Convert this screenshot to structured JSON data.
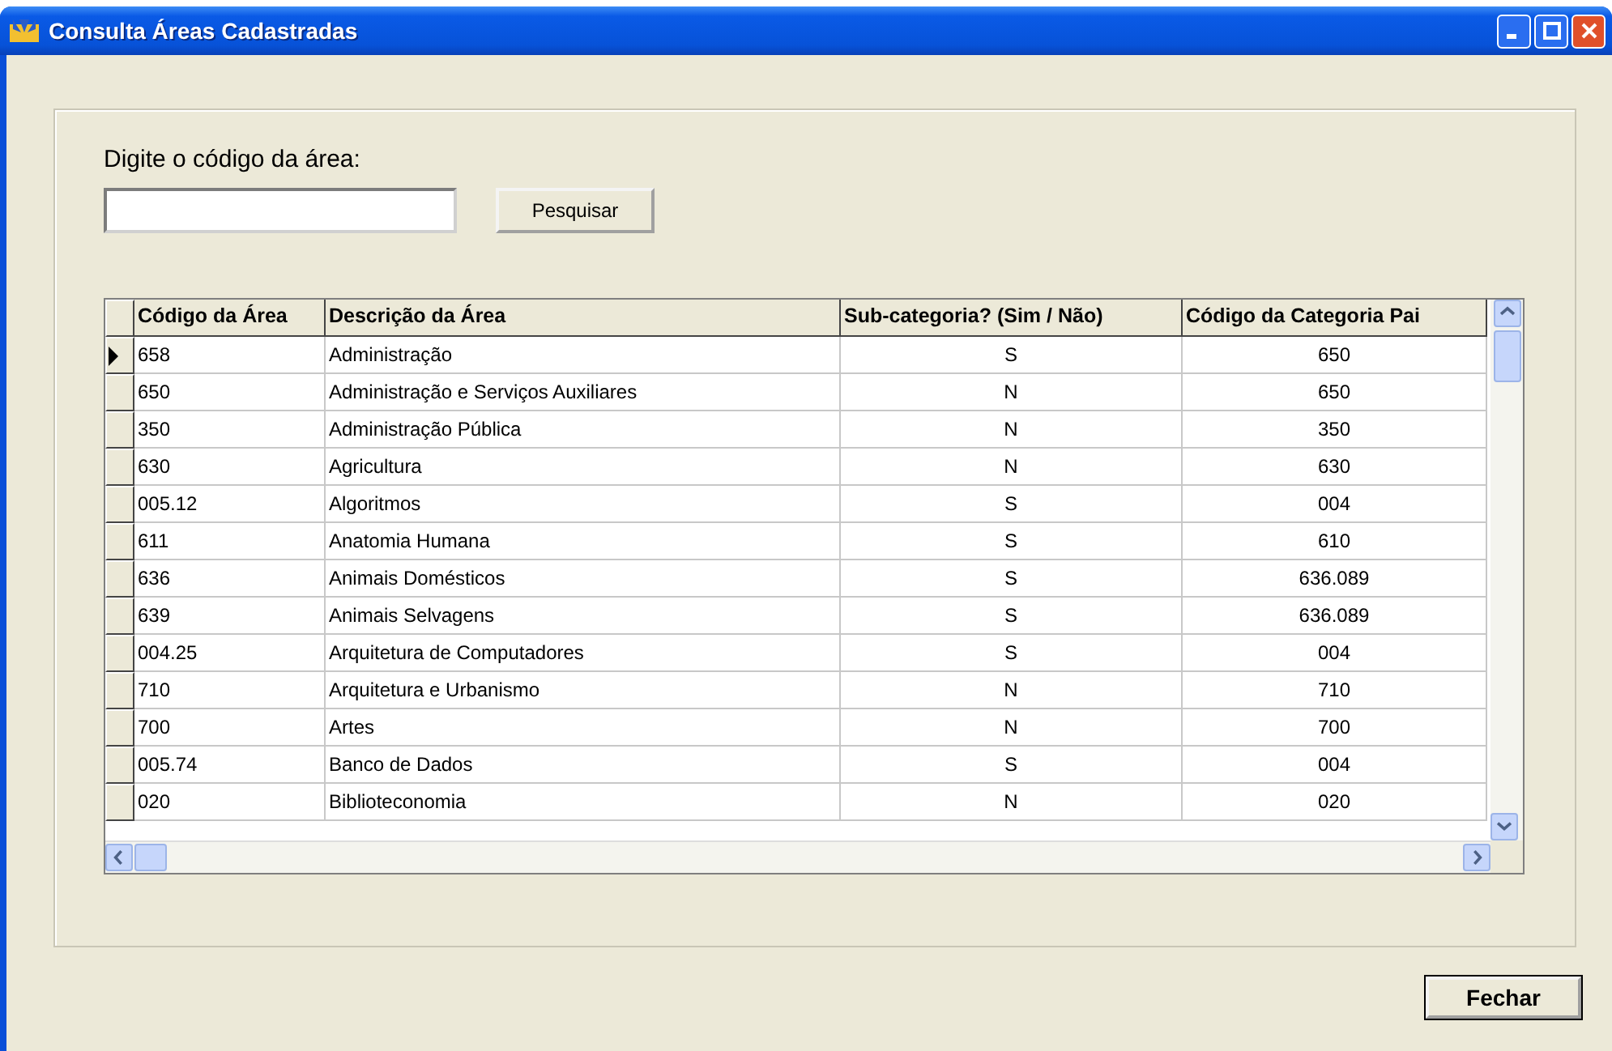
{
  "window": {
    "title": "Consulta Áreas Cadastradas"
  },
  "search": {
    "label": "Digite o código da área:",
    "button": "Pesquisar"
  },
  "table": {
    "columns": [
      "Código da Área",
      "Descrição da Área",
      "Sub-categoria? (Sim / Não)",
      "Código da Categoria Pai"
    ],
    "rows": [
      {
        "cells": [
          "658",
          "Administração",
          "S",
          "650"
        ],
        "selected": true
      },
      {
        "cells": [
          "650",
          "Administração e Serviços Auxiliares",
          "N",
          "650"
        ],
        "selected": false
      },
      {
        "cells": [
          "350",
          "Administração Pública",
          "N",
          "350"
        ],
        "selected": false
      },
      {
        "cells": [
          "630",
          "Agricultura",
          "N",
          "630"
        ],
        "selected": false
      },
      {
        "cells": [
          "005.12",
          "Algoritmos",
          "S",
          "004"
        ],
        "selected": false
      },
      {
        "cells": [
          "611",
          "Anatomia Humana",
          "S",
          "610"
        ],
        "selected": false
      },
      {
        "cells": [
          "636",
          "Animais Domésticos",
          "S",
          "636.089"
        ],
        "selected": false
      },
      {
        "cells": [
          "639",
          "Animais Selvagens",
          "S",
          "636.089"
        ],
        "selected": false
      },
      {
        "cells": [
          "004.25",
          "Arquitetura de Computadores",
          "S",
          "004"
        ],
        "selected": false
      },
      {
        "cells": [
          "710",
          "Arquitetura e Urbanismo",
          "N",
          "710"
        ],
        "selected": false
      },
      {
        "cells": [
          "700",
          "Artes",
          "N",
          "700"
        ],
        "selected": false
      },
      {
        "cells": [
          "005.74",
          "Banco de Dados",
          "S",
          "004"
        ],
        "selected": false
      },
      {
        "cells": [
          "020",
          "Biblioteconomia",
          "N",
          "020"
        ],
        "selected": false
      }
    ]
  },
  "buttons": [
    "Fechar"
  ]
}
